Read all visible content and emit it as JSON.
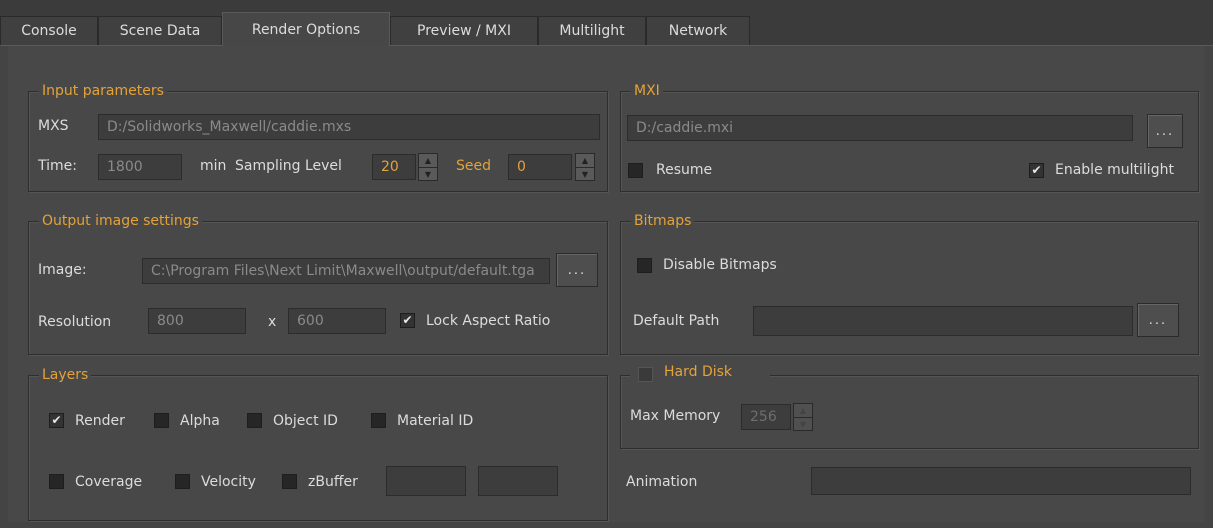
{
  "tabs": [
    {
      "label": "Console",
      "active": false
    },
    {
      "label": "Scene Data",
      "active": false
    },
    {
      "label": "Render Options",
      "active": true
    },
    {
      "label": "Preview / MXI",
      "active": false
    },
    {
      "label": "Multilight",
      "active": false
    },
    {
      "label": "Network",
      "active": false
    }
  ],
  "input_parameters": {
    "title": "Input parameters",
    "mxs_label": "MXS",
    "mxs_value": "D:/Solidworks_Maxwell/caddie.mxs",
    "time_label": "Time:",
    "time_value": "1800",
    "time_unit": "min",
    "sampling_label": "Sampling Level",
    "sampling_value": "20",
    "seed_label": "Seed",
    "seed_value": "0"
  },
  "mxi": {
    "title": "MXI",
    "path_value": "D:/caddie.mxi",
    "browse_label": "...",
    "resume_label": "Resume",
    "resume_checked": false,
    "multilight_label": "Enable multilight",
    "multilight_checked": true
  },
  "output_image": {
    "title": "Output image settings",
    "image_label": "Image:",
    "image_value": "C:\\Program Files\\Next Limit\\Maxwell\\output/default.tga",
    "browse_label": "...",
    "resolution_label": "Resolution",
    "width_value": "800",
    "x_label": "x",
    "height_value": "600",
    "lock_label": "Lock Aspect Ratio",
    "lock_checked": true
  },
  "bitmaps": {
    "title": "Bitmaps",
    "disable_label": "Disable Bitmaps",
    "disable_checked": false,
    "default_path_label": "Default Path",
    "default_path_value": "",
    "browse_label": "..."
  },
  "layers": {
    "title": "Layers",
    "render_label": "Render",
    "render_checked": true,
    "alpha_label": "Alpha",
    "alpha_checked": false,
    "object_id_label": "Object ID",
    "object_id_checked": false,
    "material_id_label": "Material ID",
    "material_id_checked": false,
    "coverage_label": "Coverage",
    "coverage_checked": false,
    "velocity_label": "Velocity",
    "velocity_checked": false,
    "zbuffer_label": "zBuffer",
    "zbuffer_checked": false,
    "zbuffer_min": "",
    "zbuffer_max": ""
  },
  "hard_disk": {
    "title": "Hard Disk",
    "checked": false,
    "max_memory_label": "Max Memory",
    "max_memory_value": "256"
  },
  "animation": {
    "label": "Animation",
    "value": ""
  },
  "colors": {
    "accent": "#e3a23a",
    "background": "#484848"
  }
}
